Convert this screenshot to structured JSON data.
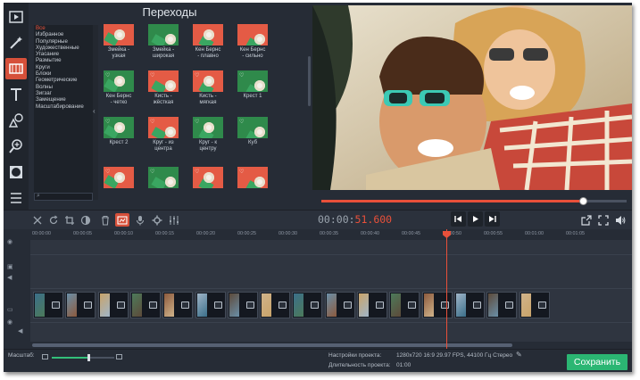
{
  "panel": {
    "title": "Переходы",
    "categories": [
      "Все",
      "Избранное",
      "Популярные",
      "Художественные",
      "Угасание",
      "Размытие",
      "Круги",
      "Блоки",
      "Геометрические",
      "Волны",
      "Зигзаг",
      "Замещение",
      "Масштабирование"
    ],
    "selected_category": "Все"
  },
  "transitions": [
    {
      "label": "Змейка - узкая",
      "lines": [
        "Змейка -",
        "узкая"
      ]
    },
    {
      "label": "Змейка - широкая",
      "lines": [
        "Змейка -",
        "широкая"
      ]
    },
    {
      "label": "Кен Бернс - плавно",
      "lines": [
        "Кен Бернс",
        "- плавно"
      ]
    },
    {
      "label": "Кен Бернс - сильно",
      "lines": [
        "Кен Бернс",
        "- сильно"
      ]
    },
    {
      "label": "Кен Бернс - четко",
      "lines": [
        "Кен Бернс",
        "- четко"
      ]
    },
    {
      "label": "Кисть - жёсткая",
      "lines": [
        "Кисть -",
        "жёсткая"
      ]
    },
    {
      "label": "Кисть - мягкая",
      "lines": [
        "Кисть -",
        "мягкая"
      ]
    },
    {
      "label": "Крест 1",
      "lines": [
        "Крест 1"
      ]
    },
    {
      "label": "Крест 2",
      "lines": [
        "Крест 2"
      ]
    },
    {
      "label": "Круг - из центра",
      "lines": [
        "Круг - из",
        "центра"
      ]
    },
    {
      "label": "Круг - к центру",
      "lines": [
        "Круг - к",
        "центру"
      ]
    },
    {
      "label": "Куб",
      "lines": [
        "Куб"
      ]
    },
    {
      "label": "",
      "lines": []
    },
    {
      "label": "",
      "lines": []
    },
    {
      "label": "",
      "lines": []
    },
    {
      "label": "",
      "lines": []
    }
  ],
  "player": {
    "timecode_gray": "00:00:",
    "timecode_red": "51.600",
    "progress": 0.857
  },
  "timeline": {
    "ticks": [
      "00:00:00",
      "00:00:05",
      "00:00:10",
      "00:00:15",
      "00:00:20",
      "00:00:25",
      "00:00:30",
      "00:00:35",
      "00:00:40",
      "00:00:45",
      "00:00:50",
      "00:00:55",
      "00:01:00",
      "00:01:05"
    ],
    "clip_count": 16
  },
  "status": {
    "scale_label": "Масштаб:",
    "zoom_level": 0.6,
    "settings_label": "Настройки проекта:",
    "settings_value": "1280x720 16:9 29.97 FPS, 44100 Гц Стерео",
    "duration_label": "Длительность проекта:",
    "duration_value": "01:00",
    "save_label": "Сохранить"
  },
  "colors": {
    "accent": "#e8503a",
    "save": "#2bb673",
    "background": "#262c36"
  }
}
